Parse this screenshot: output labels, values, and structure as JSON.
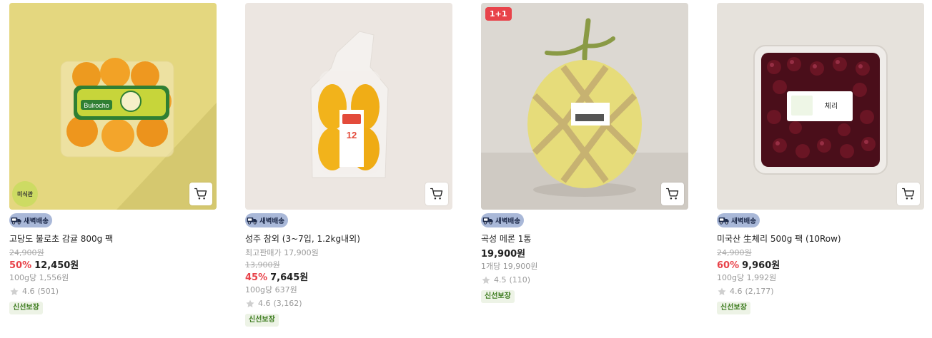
{
  "products": [
    {
      "name": "고당도 불로초 감귤 800g 팩",
      "original_price": "24,900원",
      "discount": "50%",
      "price": "12,450원",
      "unit_price": "100g당 1,556원",
      "rating": "4.6",
      "reviews": "(501)",
      "delivery": "새벽배송",
      "fresh_label": "신선보장",
      "round_badge": "미식관",
      "package_label": "Bulrocho",
      "bg_color": "#e4d77f"
    },
    {
      "name": "성주 참외 (3~7입, 1.2kg내외)",
      "best_price": "최고판매가 17,900원",
      "original_price": "13,900원",
      "discount": "45%",
      "price": "7,645원",
      "unit_price": "100g당 637원",
      "rating": "4.6",
      "reviews": "(3,162)",
      "delivery": "새벽배송",
      "fresh_label": "신선보장",
      "package_label": "12",
      "bg_color": "#ece6e1"
    },
    {
      "name": "곡성 메론 1통",
      "price": "19,900원",
      "unit_price": "1개당 19,900원",
      "rating": "4.5",
      "reviews": "(110)",
      "delivery": "새벽배송",
      "fresh_label": "신선보장",
      "promo": "1+1",
      "bg_color": "#dcd8d2"
    },
    {
      "name": "미국산 生체리 500g 팩 (10Row)",
      "original_price": "24,900원",
      "discount": "60%",
      "price": "9,960원",
      "unit_price": "100g당 1,992원",
      "rating": "4.6",
      "reviews": "(2,177)",
      "delivery": "새벽배송",
      "fresh_label": "신선보장",
      "package_label": "체리",
      "bg_color": "#e6e2dc"
    }
  ],
  "colors": {
    "discount": "#e8434a",
    "delivery_badge_bg": "#a9b8d8",
    "fresh_label_text": "#3c7b1e",
    "fresh_label_bg": "#edf3e6"
  },
  "icons": {
    "cart": "cart-icon",
    "star": "star-icon",
    "truck": "truck-icon"
  }
}
